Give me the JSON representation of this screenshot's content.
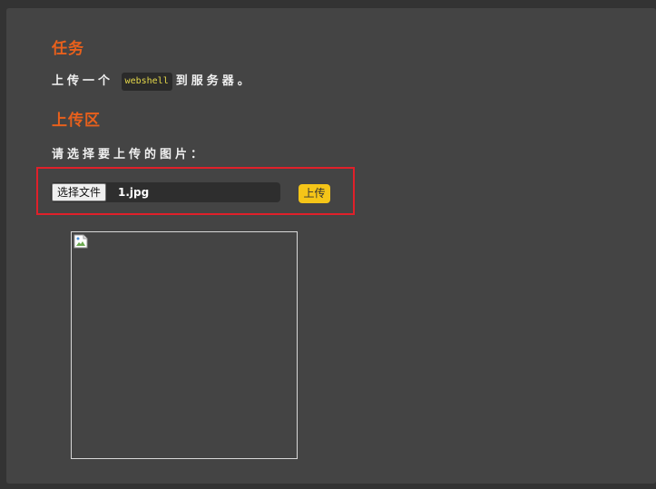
{
  "task": {
    "heading": "任务",
    "text_before": "上传一个",
    "code": "webshell",
    "text_after": "到服务器。"
  },
  "upload": {
    "heading": "上传区",
    "choose_label": "请选择要上传的图片：",
    "file_button_label": "选择文件",
    "file_name": "1.jpg",
    "submit_label": "上传"
  },
  "preview": {
    "icon": "broken-image-icon"
  },
  "colors": {
    "heading": "#e8601c",
    "submit_button": "#f5c518",
    "highlight_border": "#e0202a",
    "panel": "#444444"
  }
}
